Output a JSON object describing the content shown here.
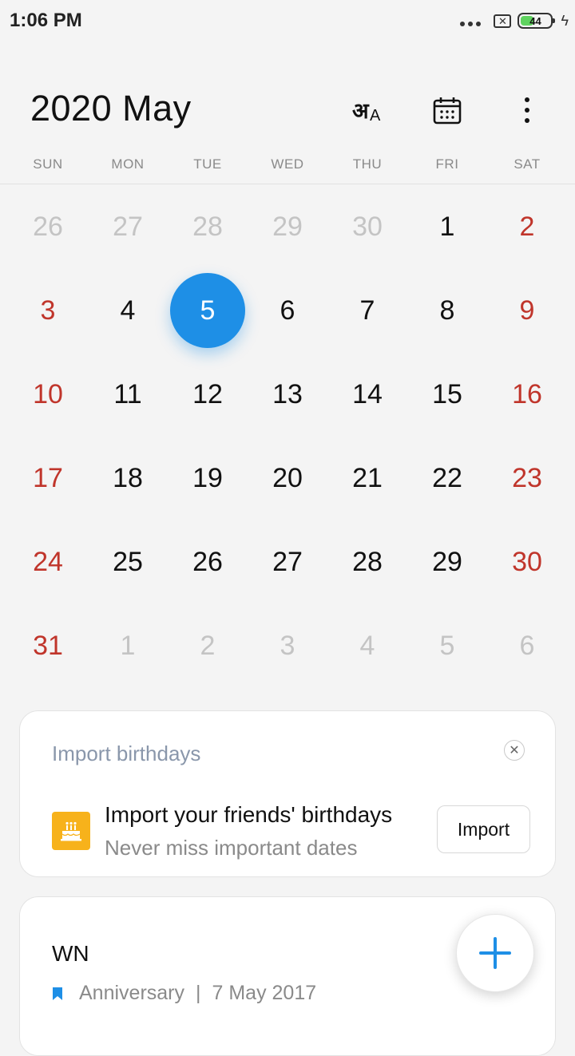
{
  "status_bar": {
    "time": "1:06 PM",
    "battery_level": "44",
    "battery_fraction": 0.44
  },
  "header": {
    "year": "2020",
    "month": "May",
    "language_icon": "hindi-language-icon",
    "calendar_icon": "calendar-today-icon",
    "more_icon": "more-vertical-icon"
  },
  "weekdays": [
    "SUN",
    "MON",
    "TUE",
    "WED",
    "THU",
    "FRI",
    "SAT"
  ],
  "calendar": {
    "selected_day": "5",
    "weeks": [
      [
        "26",
        "27",
        "28",
        "29",
        "30",
        "1",
        "2"
      ],
      [
        "3",
        "4",
        "5",
        "6",
        "7",
        "8",
        "9"
      ],
      [
        "10",
        "11",
        "12",
        "13",
        "14",
        "15",
        "16"
      ],
      [
        "17",
        "18",
        "19",
        "20",
        "21",
        "22",
        "23"
      ],
      [
        "24",
        "25",
        "26",
        "27",
        "28",
        "29",
        "30"
      ],
      [
        "31",
        "1",
        "2",
        "3",
        "4",
        "5",
        "6"
      ]
    ]
  },
  "import_card": {
    "heading": "Import  birthdays",
    "title": "Import your friends' birthdays",
    "subtitle": "Never miss important dates",
    "button_label": "Import"
  },
  "event_card": {
    "title": "WN",
    "type": "Anniversary",
    "separator": "|",
    "date": "7 May 2017"
  },
  "colors": {
    "accent": "#1e8fe6",
    "weekend": "#c0352b",
    "muted_day": "#c4c4c4",
    "birthday_icon_bg": "#f7b21b"
  }
}
